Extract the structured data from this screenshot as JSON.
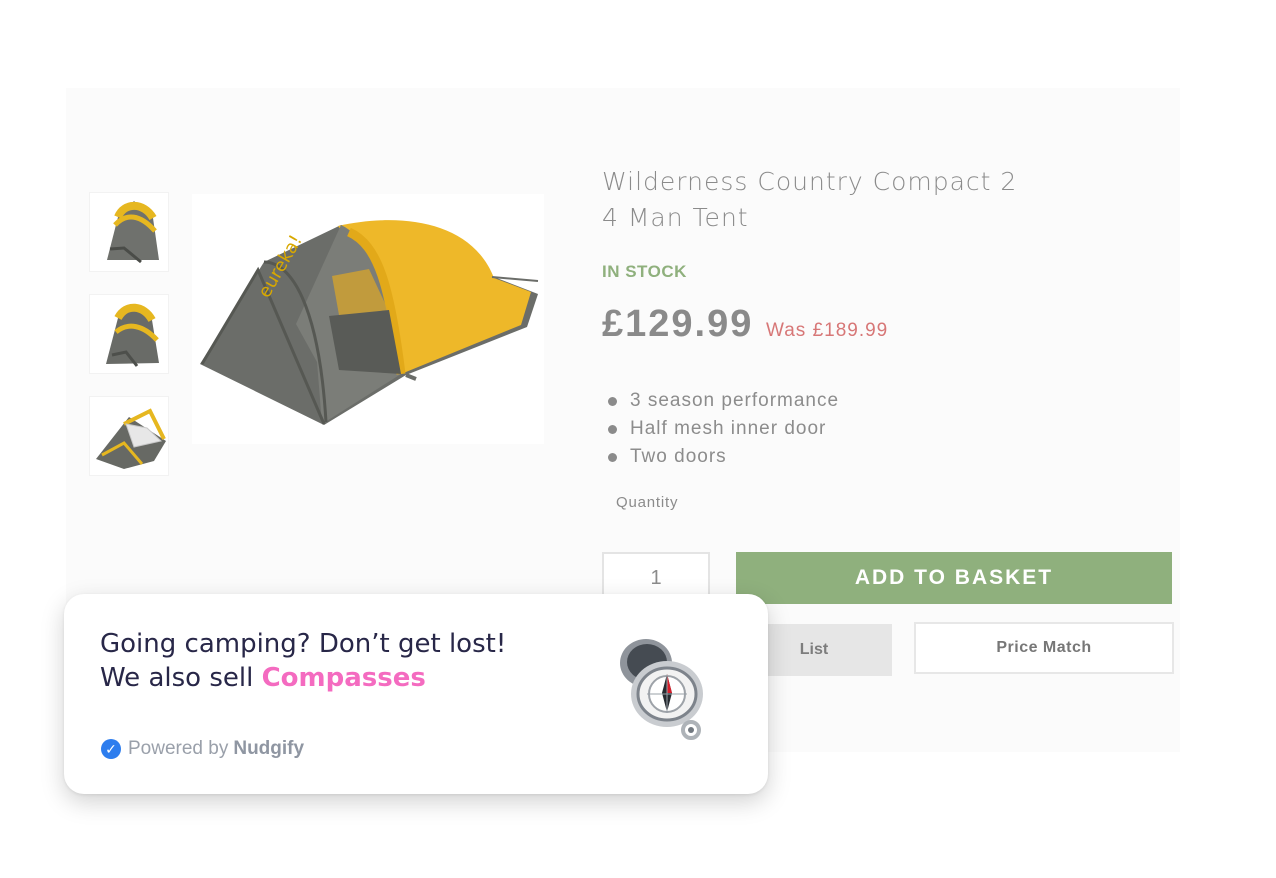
{
  "product": {
    "title_line1": "Wilderness Country Compact 2",
    "title_line2": "4 Man Tent",
    "stock_status": "IN STOCK",
    "price": "£129.99",
    "was_price": "Was £189.99",
    "features": [
      "3 season performance",
      "Half mesh inner door",
      "Two doors"
    ],
    "quantity_label": "Quantity",
    "quantity_value": "1",
    "add_to_basket_label": "ADD TO BASKET",
    "wishlist_partial_label": "List",
    "price_match_label": "Price Match"
  },
  "nudge": {
    "line1": "Going camping? Don’t get lost!",
    "line2_prefix": "We also sell ",
    "product_name": "Compasses",
    "powered_by": "Powered by",
    "brand": "Nudgify"
  },
  "colors": {
    "in_stock": "#8fb07d",
    "sale_price": "#d77777",
    "nudge_link": "#f46bc0",
    "verified": "#2d7dee"
  },
  "icons": {
    "verified": "check-icon"
  }
}
